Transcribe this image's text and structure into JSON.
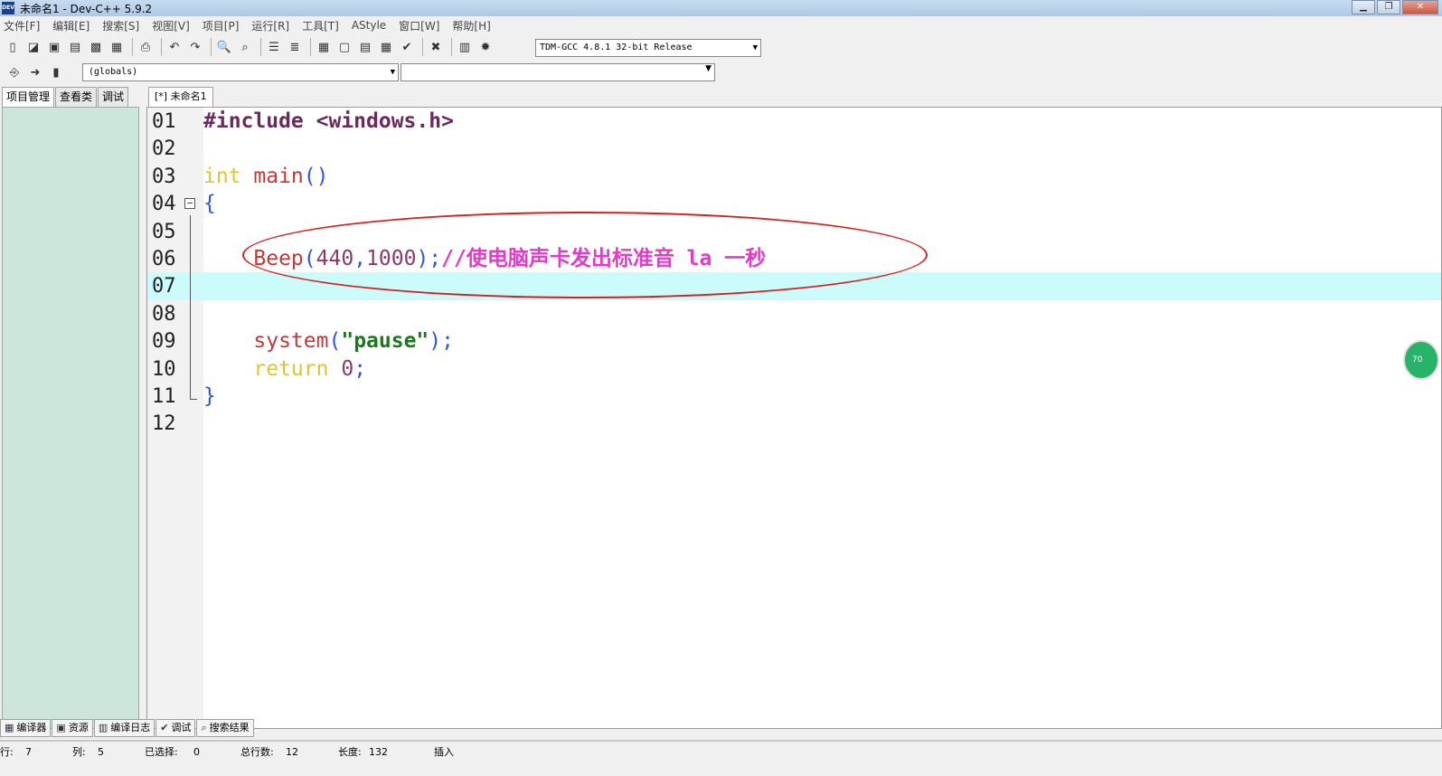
{
  "window": {
    "title": "未命名1 - Dev-C++ 5.9.2",
    "icon_text": "DEV"
  },
  "menu": [
    "文件[F]",
    "编辑[E]",
    "搜索[S]",
    "视图[V]",
    "项目[P]",
    "运行[R]",
    "工具[T]",
    "AStyle",
    "窗口[W]",
    "帮助[H]"
  ],
  "toolbar": {
    "compiler": "TDM-GCC 4.8.1 32-bit Release",
    "globals": "(globals)"
  },
  "left_tabs": [
    "项目管理",
    "查看类",
    "调试"
  ],
  "editor": {
    "tab_label": "[*] 未命名1",
    "lines": [
      {
        "n": "01",
        "parts": [
          {
            "t": "#include <windows.h>",
            "c": "kw-pp"
          }
        ]
      },
      {
        "n": "02",
        "parts": []
      },
      {
        "n": "03",
        "parts": [
          {
            "t": "int",
            "c": "kw-type"
          },
          {
            "t": " main",
            "c": "fn"
          },
          {
            "t": "()",
            "c": "punct"
          }
        ]
      },
      {
        "n": "04",
        "parts": [
          {
            "t": "{",
            "c": "punct"
          }
        ]
      },
      {
        "n": "05",
        "parts": []
      },
      {
        "n": "06",
        "parts": [
          {
            "t": "    Beep",
            "c": "fn"
          },
          {
            "t": "(",
            "c": "punct"
          },
          {
            "t": "440",
            "c": "num"
          },
          {
            "t": ",",
            "c": "punct"
          },
          {
            "t": "1000",
            "c": "num"
          },
          {
            "t": ");",
            "c": "punct"
          },
          {
            "t": "//使电脑声卡发出标准音 la 一秒",
            "c": "cmt"
          }
        ]
      },
      {
        "n": "07",
        "parts": []
      },
      {
        "n": "08",
        "parts": []
      },
      {
        "n": "09",
        "parts": [
          {
            "t": "    system",
            "c": "fn"
          },
          {
            "t": "(",
            "c": "punct"
          },
          {
            "t": "\"pause\"",
            "c": "str"
          },
          {
            "t": ");",
            "c": "punct"
          }
        ]
      },
      {
        "n": "10",
        "parts": [
          {
            "t": "    return",
            "c": "kw-type"
          },
          {
            "t": " 0",
            "c": "num"
          },
          {
            "t": ";",
            "c": "punct"
          }
        ]
      },
      {
        "n": "11",
        "parts": [
          {
            "t": "}",
            "c": "punct"
          }
        ]
      },
      {
        "n": "12",
        "parts": []
      }
    ],
    "current_line": "07"
  },
  "side_badge": "70",
  "bottom_tabs": [
    {
      "label": "编译器",
      "icon": "grid-icon"
    },
    {
      "label": "资源",
      "icon": "resources-icon"
    },
    {
      "label": "编译日志",
      "icon": "chart-icon"
    },
    {
      "label": "调试",
      "icon": "check-icon"
    },
    {
      "label": "搜索结果",
      "icon": "search-icon"
    }
  ],
  "status": {
    "row_label": "行:",
    "row": "7",
    "col_label": "列:",
    "col": "5",
    "sel_label": "已选择:",
    "sel": "0",
    "total_label": "总行数:",
    "total": "12",
    "len_label": "长度:",
    "len": "132",
    "mode": "插入"
  }
}
